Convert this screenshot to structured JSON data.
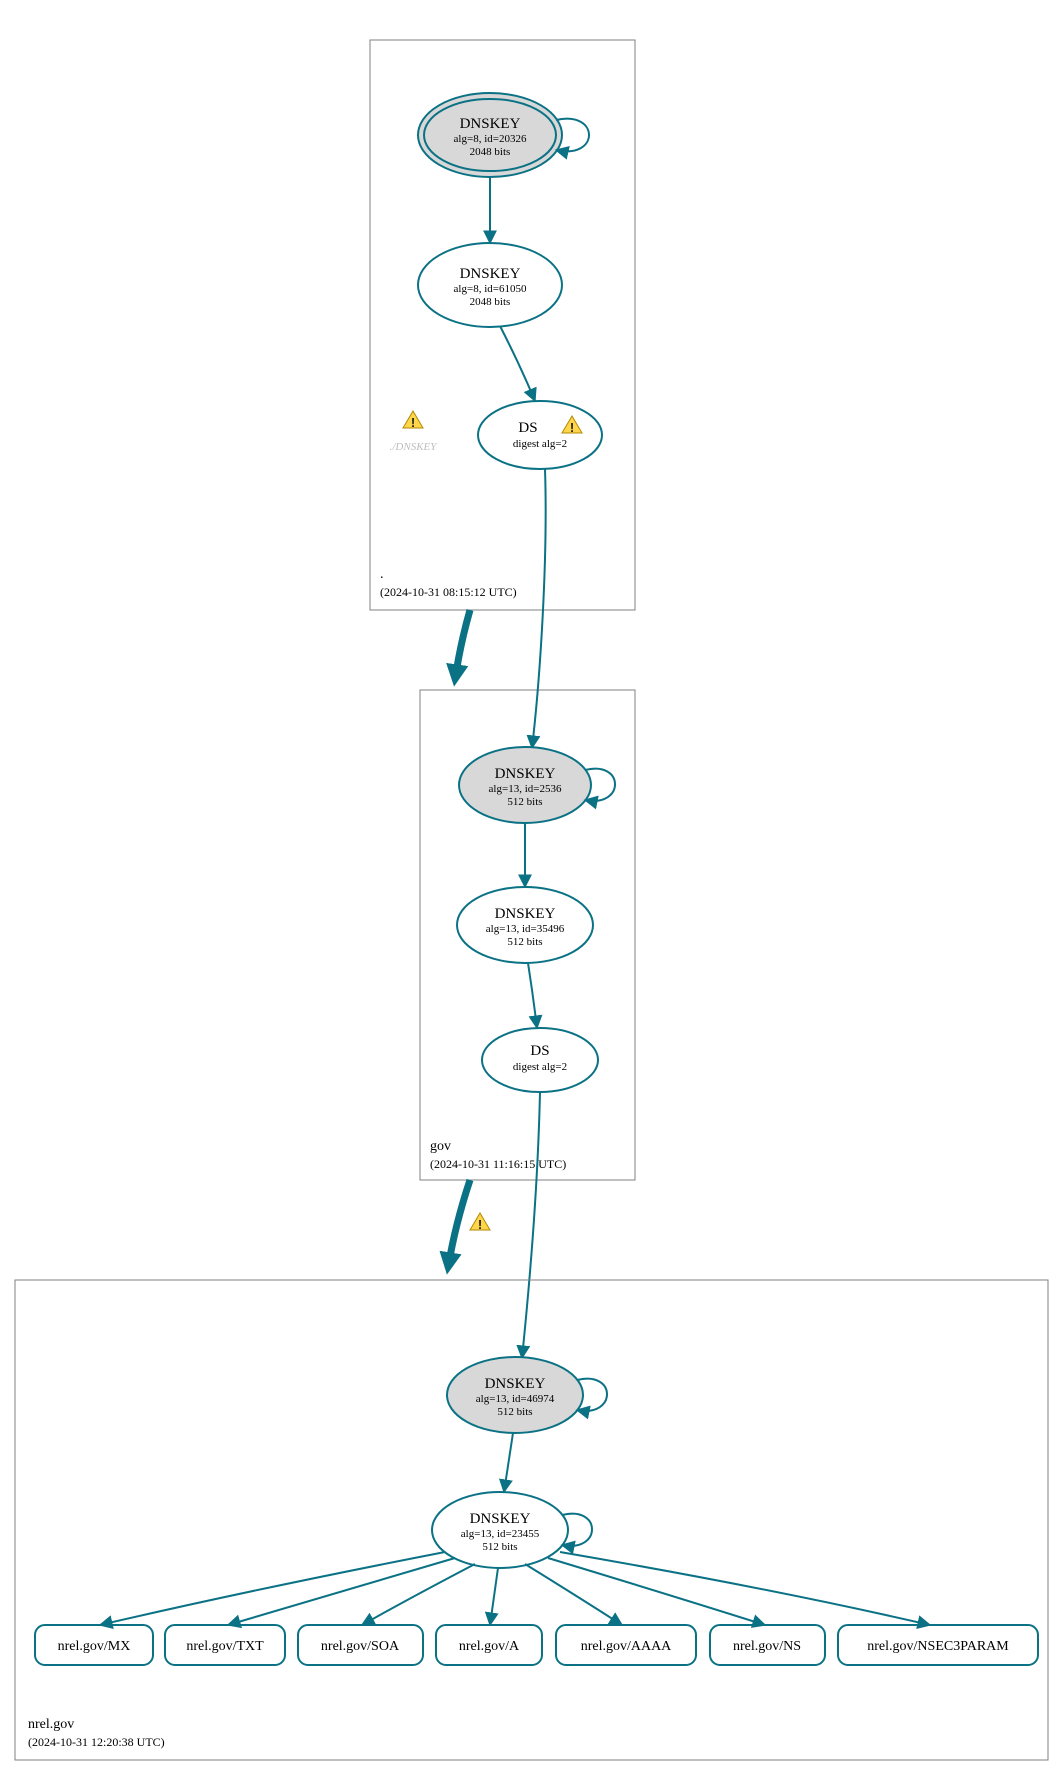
{
  "colors": {
    "stroke": "#0b7285",
    "shaded": "#d8d8d8",
    "boxStroke": "#808080",
    "warn": "#ffd54a"
  },
  "zones": {
    "root": {
      "label": ".",
      "timestamp": "(2024-10-31 08:15:12 UTC)"
    },
    "gov": {
      "label": "gov",
      "timestamp": "(2024-10-31 11:16:15 UTC)"
    },
    "nrel": {
      "label": "nrel.gov",
      "timestamp": "(2024-10-31 12:20:38 UTC)"
    }
  },
  "nodes": {
    "root_ksk": {
      "title": "DNSKEY",
      "line2": "alg=8, id=20326",
      "line3": "2048 bits"
    },
    "root_zsk": {
      "title": "DNSKEY",
      "line2": "alg=8, id=61050",
      "line3": "2048 bits"
    },
    "root_ds": {
      "title": "DS",
      "line2": "digest alg=2"
    },
    "root_faded": {
      "title": "./DNSKEY"
    },
    "gov_ksk": {
      "title": "DNSKEY",
      "line2": "alg=13, id=2536",
      "line3": "512 bits"
    },
    "gov_zsk": {
      "title": "DNSKEY",
      "line2": "alg=13, id=35496",
      "line3": "512 bits"
    },
    "gov_ds": {
      "title": "DS",
      "line2": "digest alg=2"
    },
    "nrel_ksk": {
      "title": "DNSKEY",
      "line2": "alg=13, id=46974",
      "line3": "512 bits"
    },
    "nrel_zsk": {
      "title": "DNSKEY",
      "line2": "alg=13, id=23455",
      "line3": "512 bits"
    }
  },
  "rrsets": {
    "r0": "nrel.gov/MX",
    "r1": "nrel.gov/TXT",
    "r2": "nrel.gov/SOA",
    "r3": "nrel.gov/A",
    "r4": "nrel.gov/AAAA",
    "r5": "nrel.gov/NS",
    "r6": "nrel.gov/NSEC3PARAM"
  }
}
